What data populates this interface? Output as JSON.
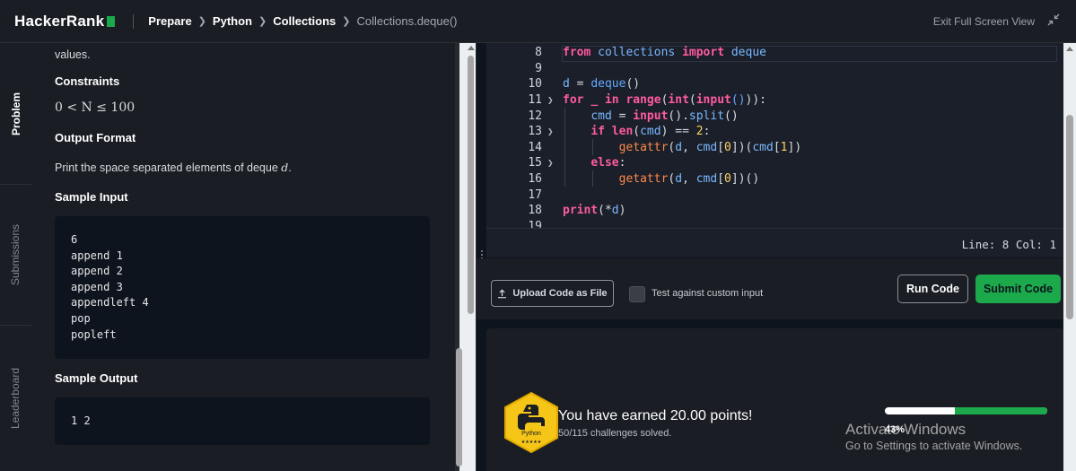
{
  "header": {
    "logo_text": "HackerRank",
    "breadcrumbs": [
      "Prepare",
      "Python",
      "Collections",
      "Collections.deque()"
    ],
    "exit_fullscreen": "Exit Full Screen View",
    "accent": "#1ba94c"
  },
  "sidenav": {
    "tabs": [
      "Problem",
      "Submissions",
      "Leaderboard"
    ],
    "active": "Problem"
  },
  "problem": {
    "intro_tail": "values.",
    "constraints_heading": "Constraints",
    "constraint_expr": "0 < N ≤ 100",
    "output_heading": "Output Format",
    "output_text": "Print the space separated elements of deque ",
    "output_var": "d",
    "output_end": ".",
    "sample_input_heading": "Sample Input",
    "sample_input_lines": [
      "6",
      "append 1",
      "append 2",
      "append 3",
      "appendleft 4",
      "pop",
      "popleft"
    ],
    "sample_output_heading": "Sample Output",
    "sample_output": "1 2"
  },
  "editor": {
    "line_numbers": [
      "8",
      "9",
      "10",
      "11",
      "12",
      "13",
      "14",
      "15",
      "16",
      "17",
      "18",
      "19"
    ],
    "status": "Line: 8 Col: 1"
  },
  "actions": {
    "upload_label": "Upload Code as File",
    "custom_input_label": "Test against custom input",
    "run_label": "Run Code",
    "submit_label": "Submit Code"
  },
  "result": {
    "badge_label": "Python",
    "earned_text": "You have earned 20.00 points!",
    "solved_text": "50/115 challenges solved.",
    "progress_percent": 43,
    "progress_label": "43%"
  },
  "watermark": {
    "title": "Activate Windows",
    "subtitle": "Go to Settings to activate Windows."
  }
}
